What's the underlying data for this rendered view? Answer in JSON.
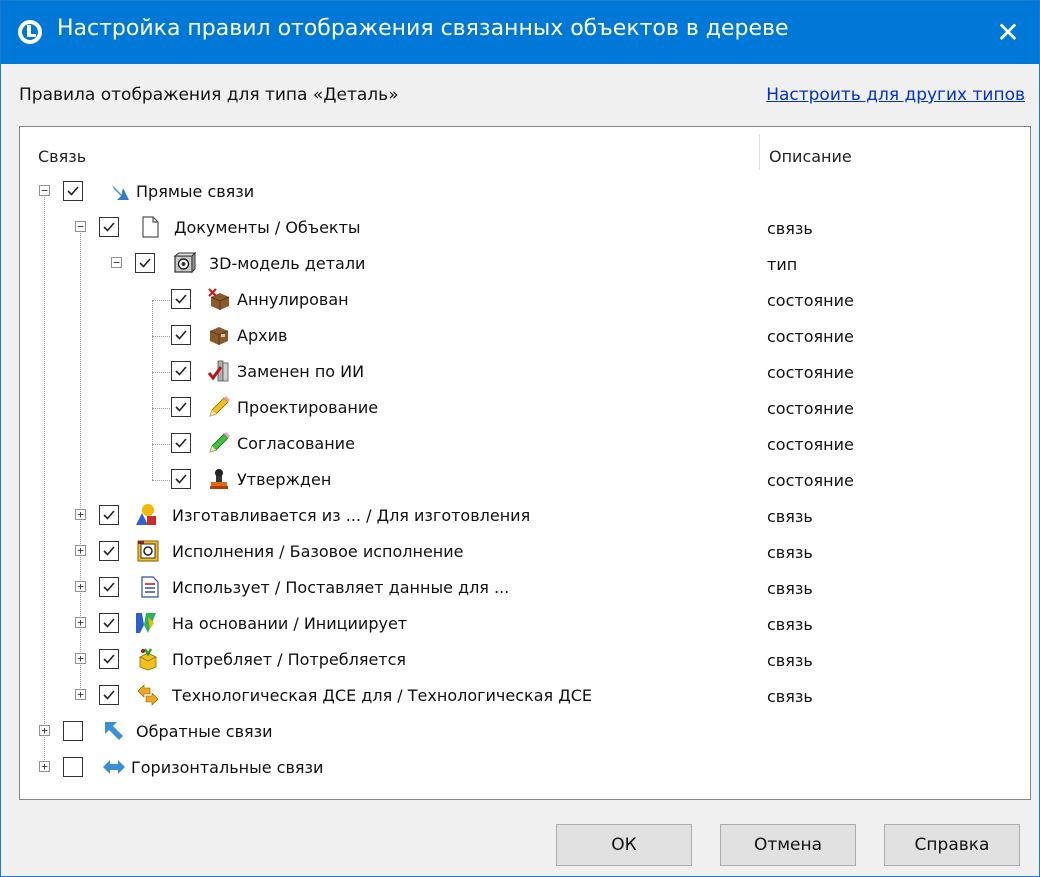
{
  "window": {
    "title": "Настройка правил отображения связанных объектов в дереве",
    "close_label": "✕"
  },
  "header": {
    "rules_label": "Правила отображения для типа «Деталь»",
    "config_link": "Настроить для других типов"
  },
  "tree": {
    "columns": [
      "Связь",
      "Описание"
    ],
    "rows": [
      {
        "label": "Прямые связи",
        "desc": "",
        "checked": true,
        "expander": "minus",
        "icon": "arrow-down-right-icon"
      },
      {
        "label": "Документы / Объекты",
        "desc": "связь",
        "checked": true,
        "expander": "minus",
        "icon": "document-icon"
      },
      {
        "label": "3D-модель детали",
        "desc": "тип",
        "checked": true,
        "expander": "minus",
        "icon": "3d-model-icon"
      },
      {
        "label": "Аннулирован",
        "desc": "состояние",
        "checked": true,
        "expander": "",
        "icon": "box-cancelled-icon"
      },
      {
        "label": "Архив",
        "desc": "состояние",
        "checked": true,
        "expander": "",
        "icon": "box-archive-icon"
      },
      {
        "label": "Заменен по ИИ",
        "desc": "состояние",
        "checked": true,
        "expander": "",
        "icon": "replaced-icon"
      },
      {
        "label": "Проектирование",
        "desc": "состояние",
        "checked": true,
        "expander": "",
        "icon": "pencil-yellow-icon"
      },
      {
        "label": "Согласование",
        "desc": "состояние",
        "checked": true,
        "expander": "",
        "icon": "pencil-green-icon"
      },
      {
        "label": "Утвержден",
        "desc": "состояние",
        "checked": true,
        "expander": "",
        "icon": "stamp-icon"
      },
      {
        "label": "Изготавливается из ... / Для изготовления",
        "desc": "связь",
        "checked": true,
        "expander": "plus",
        "icon": "shapes-icon"
      },
      {
        "label": "Исполнения / Базовое исполнение",
        "desc": "связь",
        "checked": true,
        "expander": "plus",
        "icon": "variant-icon"
      },
      {
        "label": "Использует / Поставляет данные для ...",
        "desc": "связь",
        "checked": true,
        "expander": "plus",
        "icon": "list-document-icon"
      },
      {
        "label": "На основании / Инициирует",
        "desc": "связь",
        "checked": true,
        "expander": "plus",
        "icon": "initiate-icon"
      },
      {
        "label": "Потребляет / Потребляется",
        "desc": "связь",
        "checked": true,
        "expander": "plus",
        "icon": "consume-icon"
      },
      {
        "label": "Технологическая ДСЕ для / Технологическая ДСЕ",
        "desc": "связь",
        "checked": true,
        "expander": "plus",
        "icon": "tech-arrows-icon"
      },
      {
        "label": "Обратные связи",
        "desc": "",
        "checked": false,
        "expander": "plus",
        "icon": "arrow-up-left-icon"
      },
      {
        "label": "Горизонтальные связи",
        "desc": "",
        "checked": false,
        "expander": "plus",
        "icon": "arrow-horizontal-icon"
      }
    ]
  },
  "buttons": {
    "ok": "ОК",
    "cancel": "Отмена",
    "help": "Справка"
  },
  "colors": {
    "titlebar": "#0078d7",
    "link": "#0033cc"
  }
}
